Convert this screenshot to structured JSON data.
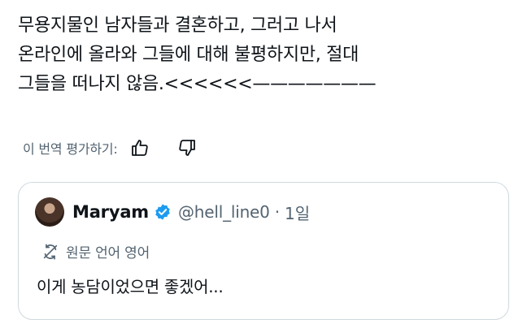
{
  "post": {
    "lines": [
      "무용지물인 남자들과 결혼하고, 그러고 나서",
      "온라인에 올라와 그들에 대해 불평하지만, 절대",
      "그들을 떠나지 않음.<<<<<<———————"
    ]
  },
  "translation_rating": {
    "label": "이 번역 평가하기:",
    "like_icon": "thumbs-up-icon",
    "dislike_icon": "thumbs-down-icon"
  },
  "quote": {
    "author_name": "Maryam",
    "handle": "@hell_line0",
    "separator": "·",
    "time": "1일",
    "verified_color": "#1d9bf0",
    "translate_label": "원문 언어 영어",
    "translate_icon": "translate-icon",
    "text": "이게 농담이었으면 좋겠어..."
  },
  "colors": {
    "text_primary": "#0f1419",
    "text_secondary": "#536471",
    "border": "#cfd9de"
  }
}
